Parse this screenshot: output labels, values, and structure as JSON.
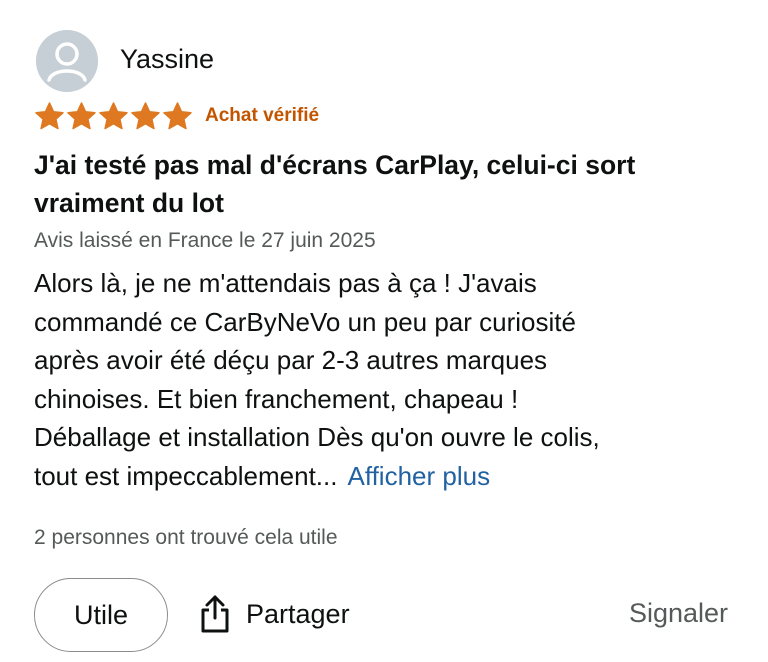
{
  "review": {
    "author": "Yassine",
    "rating": 5,
    "rating_max": 5,
    "star_color": "#de7921",
    "verified_label": "Achat vérifié",
    "title_line1": "J'ai testé pas mal d'écrans CarPlay, celui-ci sort",
    "title_line2": "vraiment du lot",
    "meta": "Avis laissé en France le 27 juin 2025",
    "body_lines": [
      "Alors là, je ne m'attendais pas à ça ! J'avais",
      "commandé ce CarByNeVo un peu par curiosité",
      "après avoir été déçu par 2-3 autres marques",
      "chinoises. Et bien franchement, chapeau !",
      "Déballage et installation Dès qu'on ouvre le colis,",
      "tout est impeccablement..."
    ],
    "show_more_label": "Afficher plus",
    "helpful_text": "2 personnes ont trouvé cela utile"
  },
  "actions": {
    "helpful_button": "Utile",
    "share_label": "Partager",
    "report_label": "Signaler"
  },
  "colors": {
    "accent_orange": "#c45500",
    "link_blue": "#2162a1",
    "muted_text": "#565959"
  },
  "icons": {
    "avatar": "user-avatar-icon",
    "star": "star-icon",
    "share": "share-icon"
  }
}
